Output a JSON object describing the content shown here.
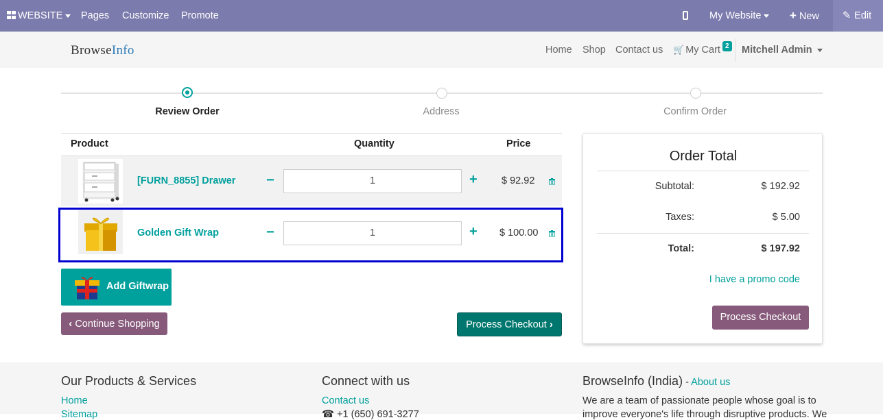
{
  "adminbar": {
    "website_label": "WEBSITE",
    "pages": "Pages",
    "customize": "Customize",
    "promote": "Promote",
    "my_website": "My Website",
    "new": "New",
    "edit": "Edit",
    "bg_color": "#7c7bad"
  },
  "header": {
    "logo_part1": "Browse",
    "logo_part2": "Info",
    "nav": {
      "home": "Home",
      "shop": "Shop",
      "contact": "Contact us",
      "cart": "My Cart",
      "cart_count": "2"
    },
    "user": "Mitchell Admin"
  },
  "steps": [
    {
      "label": "Review Order"
    },
    {
      "label": "Address"
    },
    {
      "label": "Confirm Order"
    }
  ],
  "table": {
    "headers": {
      "product": "Product",
      "quantity": "Quantity",
      "price": "Price"
    },
    "rows": [
      {
        "name": "[FURN_8855] Drawer",
        "qty": "1",
        "price": "$ 92.92"
      },
      {
        "name": "Golden Gift Wrap",
        "qty": "1",
        "price": "$ 100.00"
      }
    ]
  },
  "buttons": {
    "add_giftwrap": "Add Giftwrap",
    "continue_shopping": "Continue Shopping",
    "process_checkout": "Process Checkout"
  },
  "order_total": {
    "title": "Order Total",
    "subtotal_label": "Subtotal:",
    "subtotal": "$ 192.92",
    "taxes_label": "Taxes:",
    "taxes": "$ 5.00",
    "total_label": "Total:",
    "total": "$ 197.92",
    "promo": "I have a promo code",
    "checkout": "Process Checkout"
  },
  "footer": {
    "col1_title": "Our Products & Services",
    "col1_link1": "Home",
    "col1_link2": "Sitemap",
    "col2_title": "Connect with us",
    "col2_link1": "Contact us",
    "col2_phone": "+1 (650) 691-3277",
    "col3_title": "BrowseInfo (India)",
    "col3_sep": " - ",
    "col3_about": "About us",
    "col3_text1": "We are a team of passionate people whose goal is to",
    "col3_text2": "improve everyone's life through disruptive products. We"
  },
  "colors": {
    "accent": "#00a09d",
    "purple": "#875a7b",
    "dark_teal": "#00776e",
    "highlight_border": "#0000d0"
  },
  "icons": [
    "grid-icon",
    "mobile-icon",
    "plus-icon",
    "pencil-icon",
    "cart-icon",
    "trash-icon",
    "chevron-left-icon",
    "chevron-right-icon",
    "gift-icon"
  ]
}
